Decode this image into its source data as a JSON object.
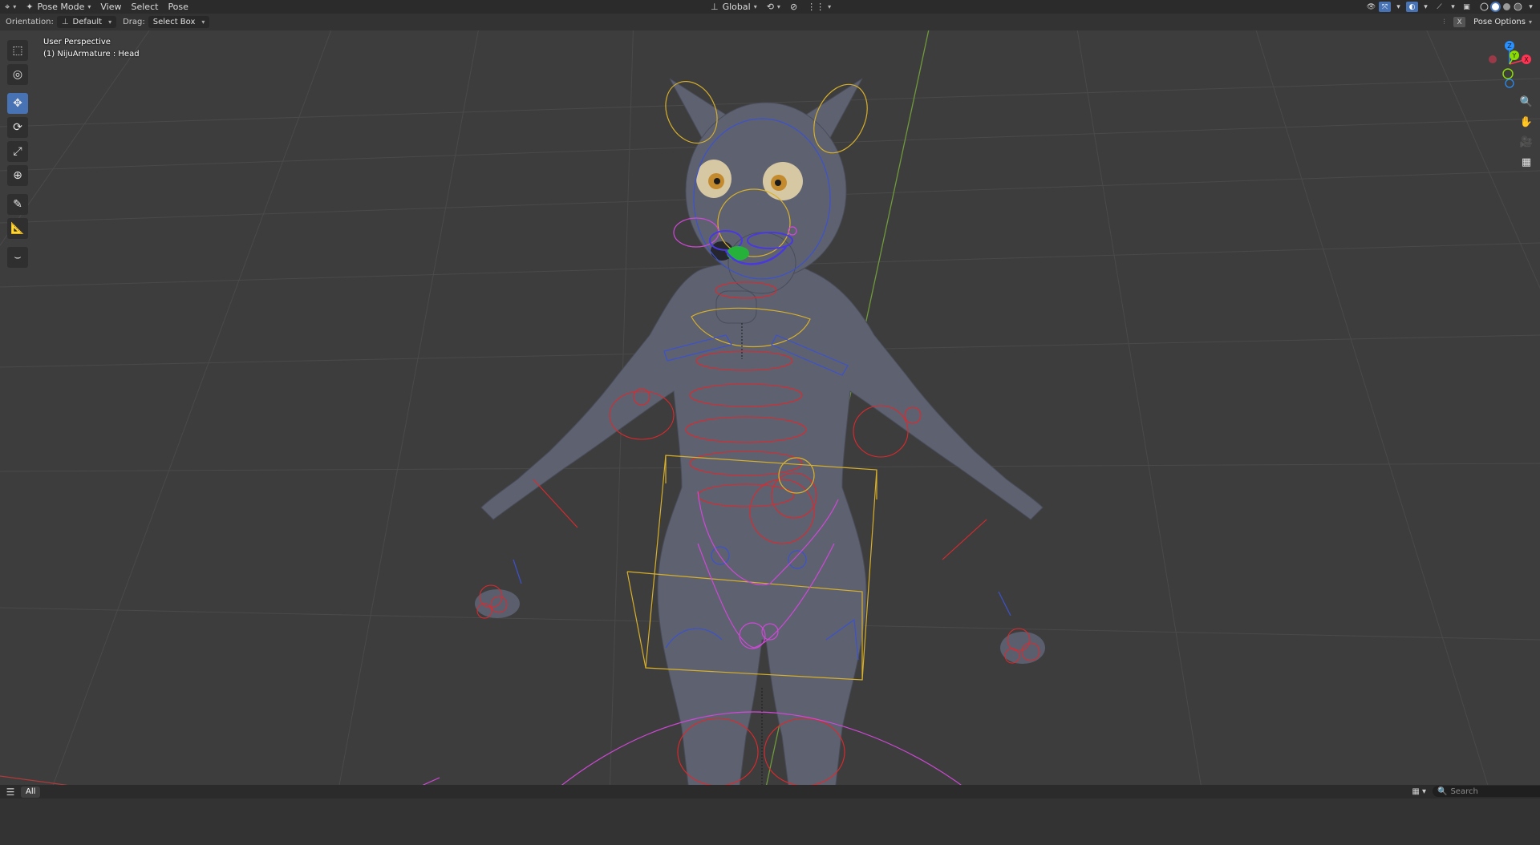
{
  "header": {
    "mode": "Pose Mode",
    "menus": [
      "View",
      "Select",
      "Pose"
    ],
    "transform_orientation": "Global"
  },
  "tool_settings": {
    "orientation_label": "Orientation:",
    "orientation_value": "Default",
    "drag_label": "Drag:",
    "drag_value": "Select Box",
    "pose_options": "Pose Options",
    "x_toggle": "X"
  },
  "viewport": {
    "view_name": "User Perspective",
    "active_object": "(1) NijuArmature : Head",
    "gizmo_axes": {
      "z": "Z",
      "y": "Y",
      "x": "X"
    }
  },
  "timeline": {
    "filter_tab": "All",
    "search_placeholder": "Search"
  },
  "colors": {
    "accent": "#4772b3",
    "bone_red": "#e0282c",
    "bone_yellow": "#d8b02a",
    "bone_blue": "#3d52cc",
    "bone_magenta": "#d048d8",
    "axis_x": "#ff3352",
    "axis_y": "#8bdc00",
    "axis_z": "#2890ff"
  }
}
